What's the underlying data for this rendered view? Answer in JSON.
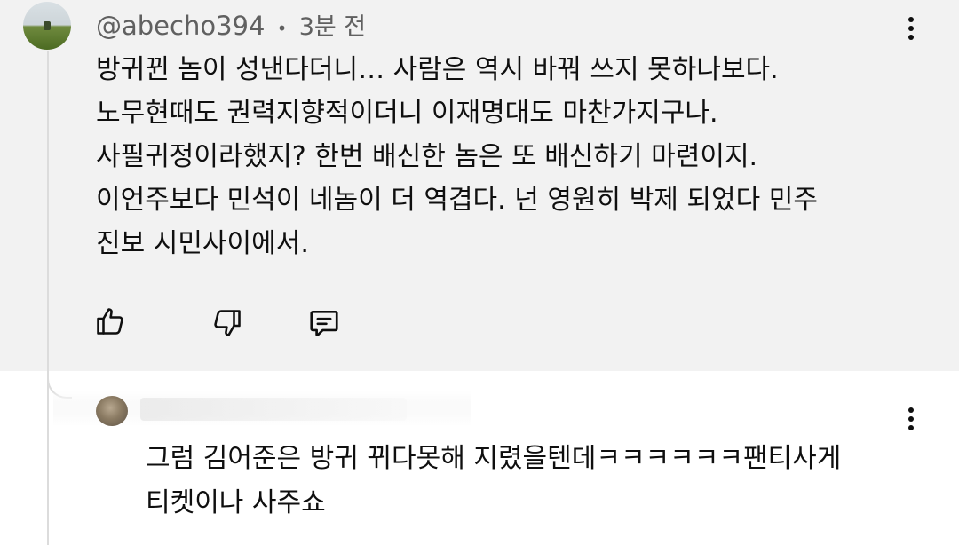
{
  "comment": {
    "handle": "@abecho394",
    "separator": "•",
    "timestamp": "3분 전",
    "lines": [
      "방귀뀐 놈이 성낸다더니… 사람은 역시 바꿔 쓰지 못하나보다.",
      "노무현때도 권력지향적이더니 이재명대도 마찬가지구나.",
      "사필귀정이라했지? 한번 배신한 놈은 또 배신하기 마련이지.",
      "이언주보다 민석이 네놈이 더 역겹다. 넌 영원히 박제 되었다 민주",
      "진보 시민사이에서."
    ],
    "actions": {
      "like_icon": "thumbs-up-icon",
      "dislike_icon": "thumbs-down-icon",
      "reply_icon": "reply-icon"
    }
  },
  "reply": {
    "lines": [
      "그럼 김어준은 방귀 뀌다못해 지렸을텐데ㅋㅋㅋㅋㅋㅋ팬티사게",
      "티켓이나 사주쇼"
    ]
  }
}
